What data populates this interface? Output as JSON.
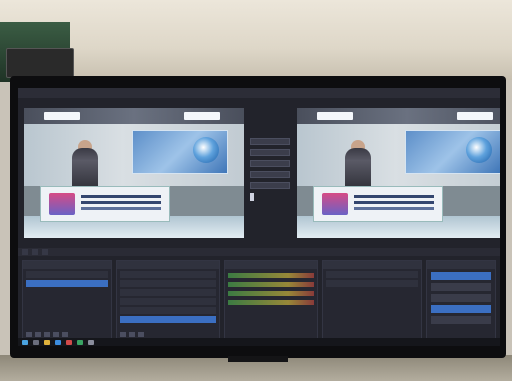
{
  "app": {
    "menu": [
      "",
      "",
      "",
      ""
    ]
  },
  "preview": {
    "label": ""
  },
  "program": {
    "label": ""
  },
  "docks": {
    "tabs": [
      "",
      "",
      ""
    ],
    "scenes": {
      "header": "",
      "items": [
        "",
        ""
      ]
    },
    "sources": {
      "header": "",
      "items": [
        "",
        "",
        "",
        "",
        "",
        ""
      ]
    },
    "mixer": {
      "header": ""
    },
    "audio": {
      "header": ""
    },
    "controls": {
      "header": "",
      "buttons": [
        "",
        "",
        "",
        "",
        ""
      ]
    }
  },
  "taskbar": {
    "clock": ""
  },
  "colors": {
    "accent": "#3b6fc2",
    "panel_bg": "#262731",
    "window_bg": "#22232b",
    "studio_purple": "#b14ab8"
  },
  "icons": [
    "gear-icon",
    "plus-icon",
    "minus-icon",
    "up-arrow-icon",
    "down-arrow-icon",
    "windows-start-icon"
  ]
}
